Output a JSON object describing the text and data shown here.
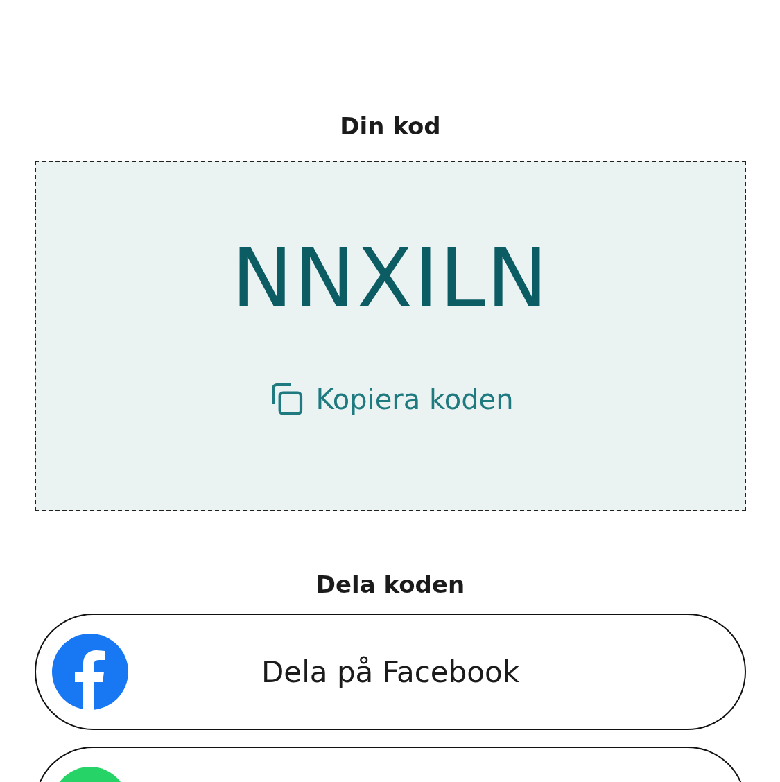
{
  "code_section": {
    "heading": "Din kod",
    "code": "NNXILN",
    "copy_button": {
      "label": "Kopiera koden"
    }
  },
  "share_section": {
    "heading": "Dela koden",
    "buttons": [
      {
        "kind": "facebook",
        "label": "Dela på Facebook"
      },
      {
        "kind": "whatsapp"
      }
    ]
  }
}
